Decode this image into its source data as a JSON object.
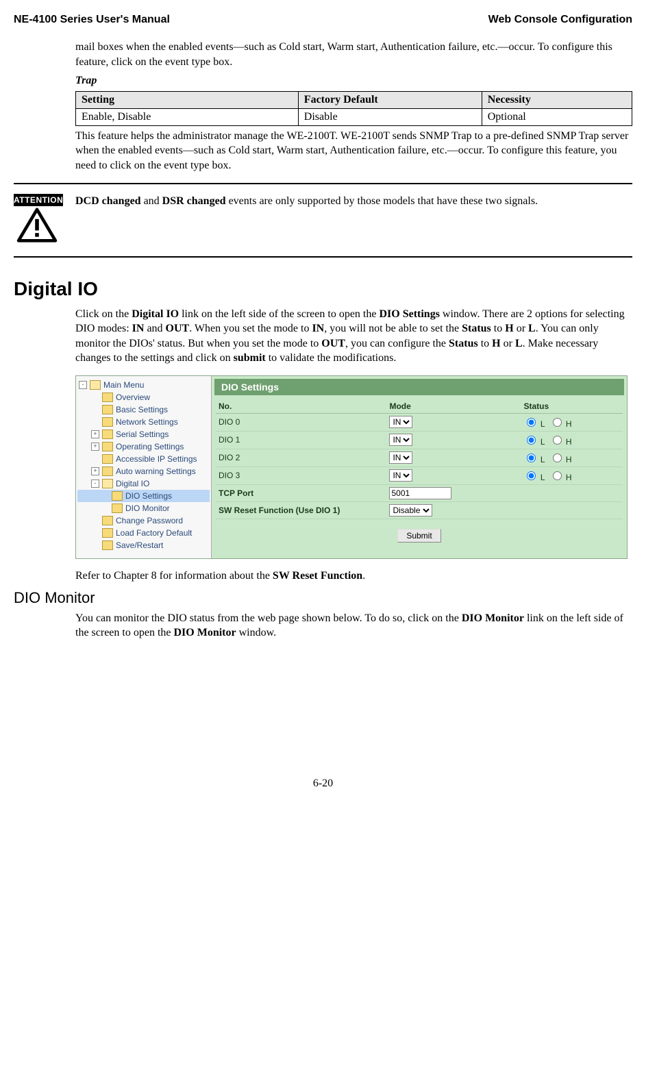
{
  "header": {
    "left": "NE-4100 Series User's Manual",
    "right": "Web Console Configuration"
  },
  "intro_top": "mail boxes when the enabled events—such as Cold start, Warm start, Authentication failure, etc.—occur. To configure this feature, click on the event type box.",
  "trap": {
    "title": "Trap",
    "headers": [
      "Setting",
      "Factory Default",
      "Necessity"
    ],
    "row": [
      "Enable, Disable",
      "Disable",
      "Optional"
    ],
    "desc": "This feature helps the administrator manage the WE-2100T. WE-2100T sends SNMP Trap to a pre-defined SNMP Trap server when the enabled events—such as Cold start, Warm start, Authentication failure, etc.—occur. To configure this feature, you need to click on the event type box."
  },
  "attention": {
    "label": "ATTENTION",
    "bold1": "DCD changed",
    "mid": " and ",
    "bold2": "DSR changed",
    "rest": " events are only supported by those models that have these two signals."
  },
  "digital_io": {
    "heading": "Digital IO",
    "p1_pre": "Click on the ",
    "p1_b1": "Digital IO",
    "p1_mid1": " link on the left side of the screen to open the ",
    "p1_b2": "DIO Settings",
    "p1_mid2": " window. There are 2 options for selecting DIO modes: ",
    "p1_b3": "IN",
    "p1_mid3": " and ",
    "p1_b4": "OUT",
    "p1_mid4": ". When you set the mode to ",
    "p1_b5": "IN",
    "p1_mid5": ", you will not be able to set the ",
    "p1_b6": "Status",
    "p1_mid6": " to ",
    "p1_b7": "H",
    "p1_mid7": " or ",
    "p1_b8": "L",
    "p1_mid8": ". You can only monitor the DIOs' status. But when you set the mode to ",
    "p1_b9": "OUT",
    "p1_mid9": ", you can configure the ",
    "p1_b10": "Status",
    "p1_mid10": " to ",
    "p1_b11": "H",
    "p1_mid11": " or ",
    "p1_b12": "L",
    "p1_mid12": ". Make necessary changes to the settings and click on ",
    "p1_b13": "submit",
    "p1_mid13": " to validate the modifications.",
    "after_ss_pre": "Refer to Chapter 8 for information about the ",
    "after_ss_b": "SW Reset Function",
    "after_ss_post": "."
  },
  "screenshot": {
    "title": "DIO Settings",
    "tree": {
      "root": "Main Menu",
      "items": [
        {
          "label": "Overview",
          "depth": 1,
          "pm": ""
        },
        {
          "label": "Basic Settings",
          "depth": 1,
          "pm": ""
        },
        {
          "label": "Network Settings",
          "depth": 1,
          "pm": ""
        },
        {
          "label": "Serial Settings",
          "depth": 1,
          "pm": "+"
        },
        {
          "label": "Operating Settings",
          "depth": 1,
          "pm": "+"
        },
        {
          "label": "Accessible IP Settings",
          "depth": 1,
          "pm": ""
        },
        {
          "label": "Auto warning Settings",
          "depth": 1,
          "pm": "+"
        },
        {
          "label": "Digital IO",
          "depth": 1,
          "pm": "-",
          "open": true
        },
        {
          "label": "DIO Settings",
          "depth": 2,
          "pm": "",
          "selected": true
        },
        {
          "label": "DIO Monitor",
          "depth": 2,
          "pm": ""
        },
        {
          "label": "Change Password",
          "depth": 1,
          "pm": ""
        },
        {
          "label": "Load Factory Default",
          "depth": 1,
          "pm": ""
        },
        {
          "label": "Save/Restart",
          "depth": 1,
          "pm": ""
        }
      ]
    },
    "table": {
      "headers": [
        "No.",
        "Mode",
        "Status"
      ],
      "rows": [
        {
          "no": "DIO 0",
          "mode": "IN",
          "status_sel": "L"
        },
        {
          "no": "DIO 1",
          "mode": "IN",
          "status_sel": "L"
        },
        {
          "no": "DIO 2",
          "mode": "IN",
          "status_sel": "L"
        },
        {
          "no": "DIO 3",
          "mode": "IN",
          "status_sel": "L"
        }
      ],
      "tcp_port_label": "TCP Port",
      "tcp_port_value": "5001",
      "sw_reset_label": "SW Reset Function (Use DIO 1)",
      "sw_reset_value": "Disable",
      "status_opts": {
        "L": "L",
        "H": "H"
      }
    },
    "submit": "Submit"
  },
  "dio_monitor": {
    "heading": "DIO Monitor",
    "p_pre": "You can monitor the DIO status from the web page shown below. To do so, click on the ",
    "p_b1": "DIO Monitor",
    "p_mid": " link on the left side of the screen to open the ",
    "p_b2": "DIO Monitor",
    "p_post": " window."
  },
  "page_num": "6-20"
}
